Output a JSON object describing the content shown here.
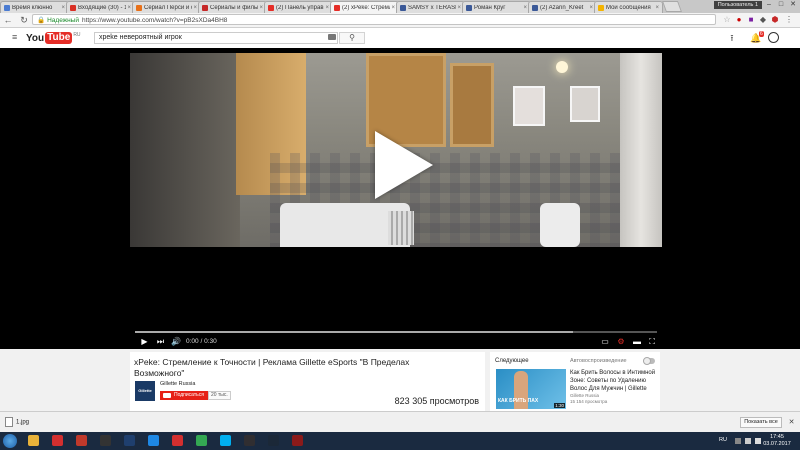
{
  "tabs": [
    {
      "label": "Время клюнно",
      "color": "#4a7bd1",
      "active": false
    },
    {
      "label": "Входящие (30) - 1",
      "color": "#d93025",
      "active": false
    },
    {
      "label": "Сериал Перси и с",
      "color": "#e8711a",
      "active": false
    },
    {
      "label": "Сериалы и фильм",
      "color": "#c62828",
      "active": false
    },
    {
      "label": "(2) Панель управ",
      "color": "#e52d27",
      "active": false
    },
    {
      "label": "(2) xPeke: Стремле",
      "color": "#e52d27",
      "active": true
    },
    {
      "label": "SAMSY x TERASHI",
      "color": "#3b5998",
      "active": false
    },
    {
      "label": "Роман Круг",
      "color": "#3b5998",
      "active": false
    },
    {
      "label": "(2) Azarin_Kreet",
      "color": "#3b5998",
      "active": false
    },
    {
      "label": "Мои сообщения",
      "color": "#f4b400",
      "active": false
    }
  ],
  "profile_label": "Пользователь 1",
  "address_bar": {
    "secure_label": "Надежный",
    "url": "https://www.youtube.com/watch?v=pB2sXDa4BH8"
  },
  "youtube": {
    "logo_you": "You",
    "logo_tube": "Tube",
    "logo_region": "RU",
    "search_value": "xpeke невероятный игрок",
    "notifications_count": "6"
  },
  "player": {
    "time_display": "0:00 / 0:30",
    "progress_played": 0.0,
    "progress_loaded": 0.84
  },
  "video": {
    "title": "xPeke: Стремление к Точности | Реклама Gillette eSports \"В Пределах Возможного\"",
    "channel": "Gillette Russia",
    "channel_logo": "Gillette",
    "subscribe_label": "Подписаться",
    "subscriber_count": "20 тыс.",
    "views": "823 305 просмотров"
  },
  "sidebar": {
    "next_label": "Следующее",
    "autoplay_label": "Автовоспроизведение",
    "next_video": {
      "title": "Как Брить Волосы в Интимной Зоне: Советы по Удалению Волос Для Мужчин | Gillette",
      "channel": "Gillette Russia",
      "views": "15 154 просмотра",
      "duration": "1:30",
      "thumb_text": "КАК БРИТЬ ПАХ"
    }
  },
  "downloads": {
    "file_name": "1.jpg",
    "show_all_label": "Показать все"
  },
  "taskbar": {
    "language": "RU",
    "time": "17:45",
    "date": "03.07.2017",
    "apps": [
      {
        "name": "folder",
        "color": "#e8b23a"
      },
      {
        "name": "download",
        "color": "#d32f2f"
      },
      {
        "name": "app",
        "color": "#c0392b"
      },
      {
        "name": "terminal",
        "color": "#333333"
      },
      {
        "name": "photoshop",
        "color": "#1f3f6e"
      },
      {
        "name": "ie",
        "color": "#1e88e5"
      },
      {
        "name": "opera",
        "color": "#d32f2f"
      },
      {
        "name": "chrome",
        "color": "#34a853"
      },
      {
        "name": "skype",
        "color": "#00aff0"
      },
      {
        "name": "obs",
        "color": "#302e31"
      },
      {
        "name": "steam",
        "color": "#1b2838"
      },
      {
        "name": "app2",
        "color": "#8b1a1a"
      }
    ]
  }
}
